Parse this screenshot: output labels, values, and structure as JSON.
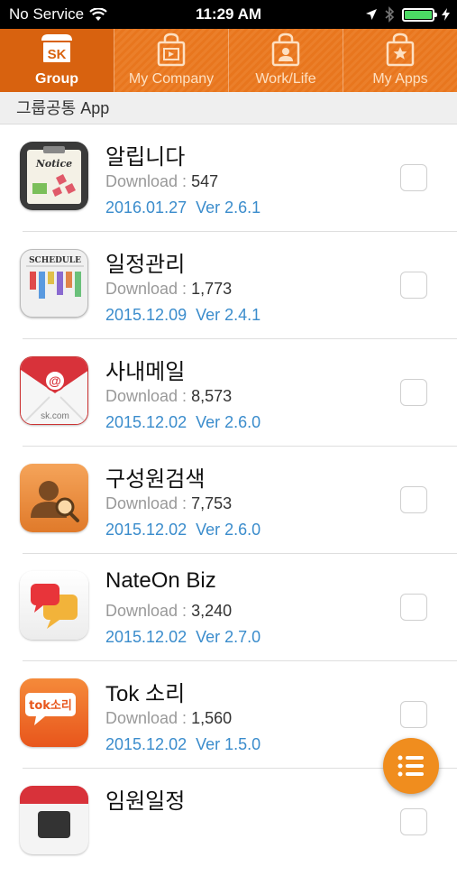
{
  "status_bar": {
    "carrier": "No Service",
    "time": "11:29 AM"
  },
  "tabs": [
    {
      "line1": "SK",
      "label": "Group",
      "active": true,
      "icon": "sk-store-icon"
    },
    {
      "label": "My Company",
      "active": false,
      "icon": "company-bag-icon"
    },
    {
      "label": "Work/Life",
      "active": false,
      "icon": "person-bag-icon"
    },
    {
      "label": "My Apps",
      "active": false,
      "icon": "star-bag-icon"
    }
  ],
  "section_header": "그룹공통 App",
  "download_label": "Download : ",
  "apps": [
    {
      "name": "알립니다",
      "downloads": "547",
      "date": "2016.01.27",
      "version": "Ver 2.6.1",
      "icon": "notice-icon",
      "icon_text": "Notice"
    },
    {
      "name": "일정관리",
      "downloads": "1,773",
      "date": "2015.12.09",
      "version": "Ver 2.4.1",
      "icon": "schedule-icon",
      "icon_text": "SCHEDULE"
    },
    {
      "name": "사내메일",
      "downloads": "8,573",
      "date": "2015.12.02",
      "version": "Ver 2.6.0",
      "icon": "mail-icon",
      "icon_text": "sk.com"
    },
    {
      "name": "구성원검색",
      "downloads": "7,753",
      "date": "2015.12.02",
      "version": "Ver 2.6.0",
      "icon": "member-search-icon"
    },
    {
      "name": "NateOn Biz",
      "downloads": "3,240",
      "date": "2015.12.02",
      "version": "Ver 2.7.0",
      "icon": "nateon-icon"
    },
    {
      "name": "Tok 소리",
      "downloads": "1,560",
      "date": "2015.12.02",
      "version": "Ver 1.5.0",
      "icon": "tok-icon",
      "icon_text": "tok소리"
    },
    {
      "name": "임원일정",
      "downloads": "",
      "date": "",
      "version": "",
      "icon": "calendar-icon"
    }
  ],
  "colors": {
    "tab_orange": "#e8761e",
    "tab_active": "#d8620f",
    "link_blue": "#3a8ccc",
    "fab_orange": "#f08d1e"
  }
}
